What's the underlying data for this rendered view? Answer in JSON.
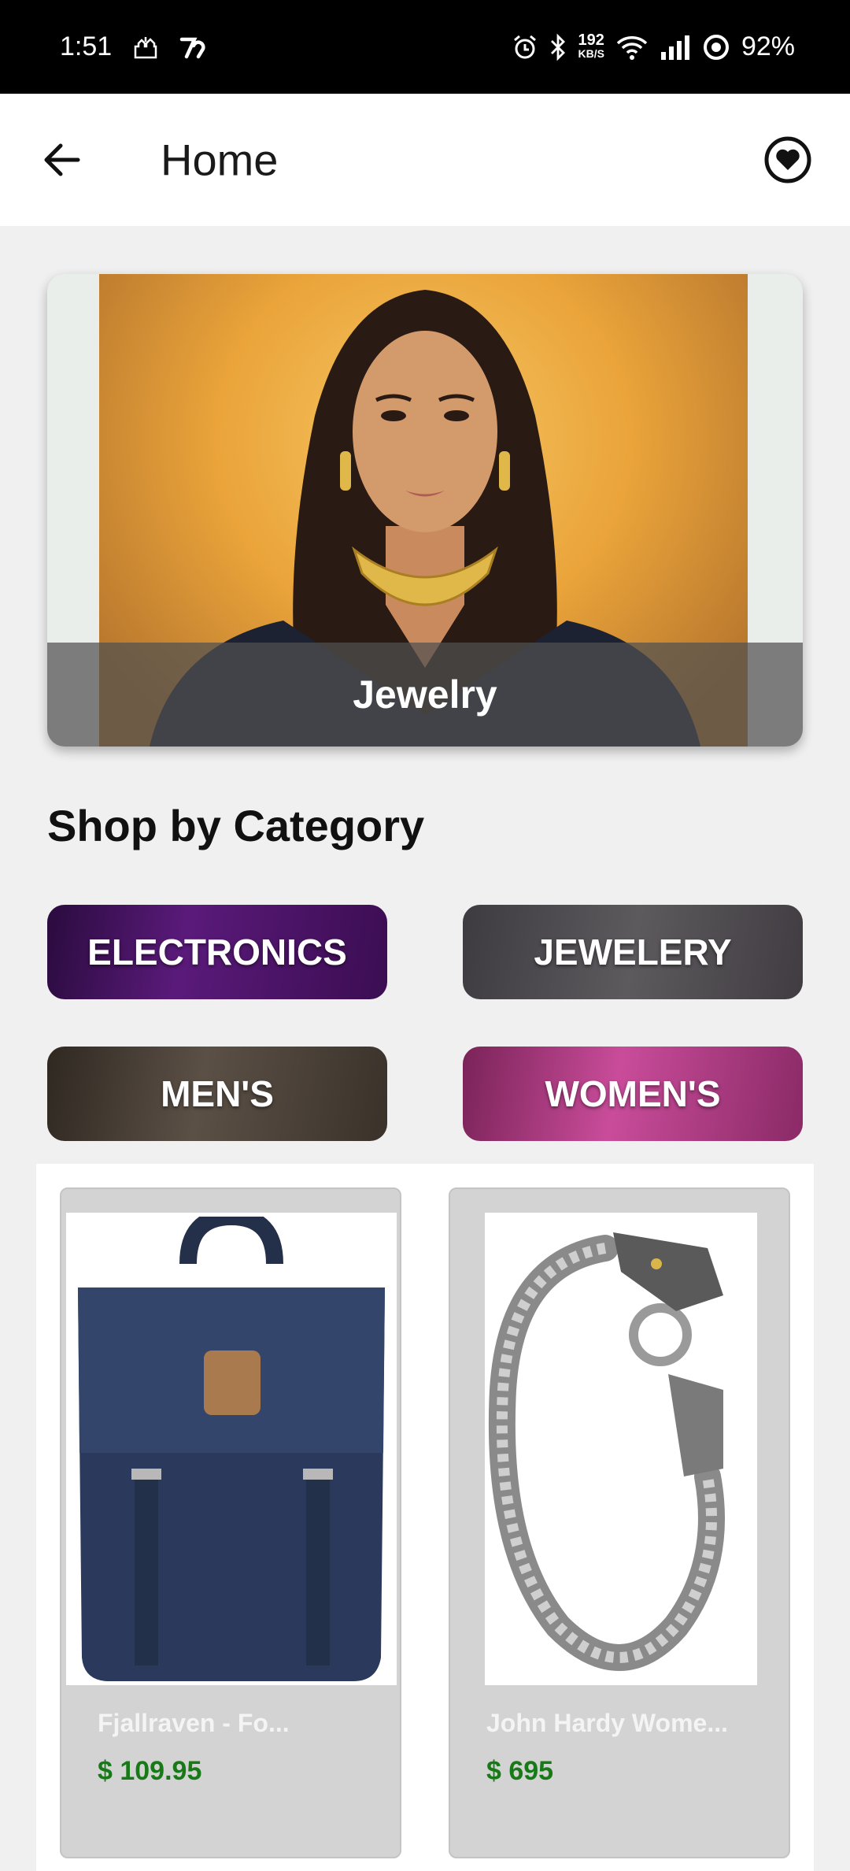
{
  "status_bar": {
    "time": "1:51",
    "net_speed_value": "192",
    "net_speed_unit": "KB/S",
    "battery": "92%",
    "icons": [
      "mosque-icon",
      "app-7-icon",
      "alarm-icon",
      "bluetooth-icon",
      "wifi-icon",
      "signal-icon",
      "battery-ring-icon"
    ]
  },
  "app_bar": {
    "title": "Home",
    "back_icon": "arrow-left-icon",
    "favorite_icon": "heart-circle-icon"
  },
  "hero": {
    "caption": "Jewelry"
  },
  "section": {
    "title": "Shop by Category"
  },
  "categories": [
    {
      "label": "ELECTRONICS"
    },
    {
      "label": "JEWELERY"
    },
    {
      "label": "MEN'S"
    },
    {
      "label": "WOMEN'S"
    }
  ],
  "products": [
    {
      "name": "Fjallraven - Fo...",
      "price": "$ 109.95"
    },
    {
      "name": "John Hardy Wome...",
      "price": "$ 695"
    }
  ],
  "colors": {
    "price_green": "#177a16",
    "card_bg": "#d3d3d3",
    "status_bar_bg": "#000000"
  }
}
